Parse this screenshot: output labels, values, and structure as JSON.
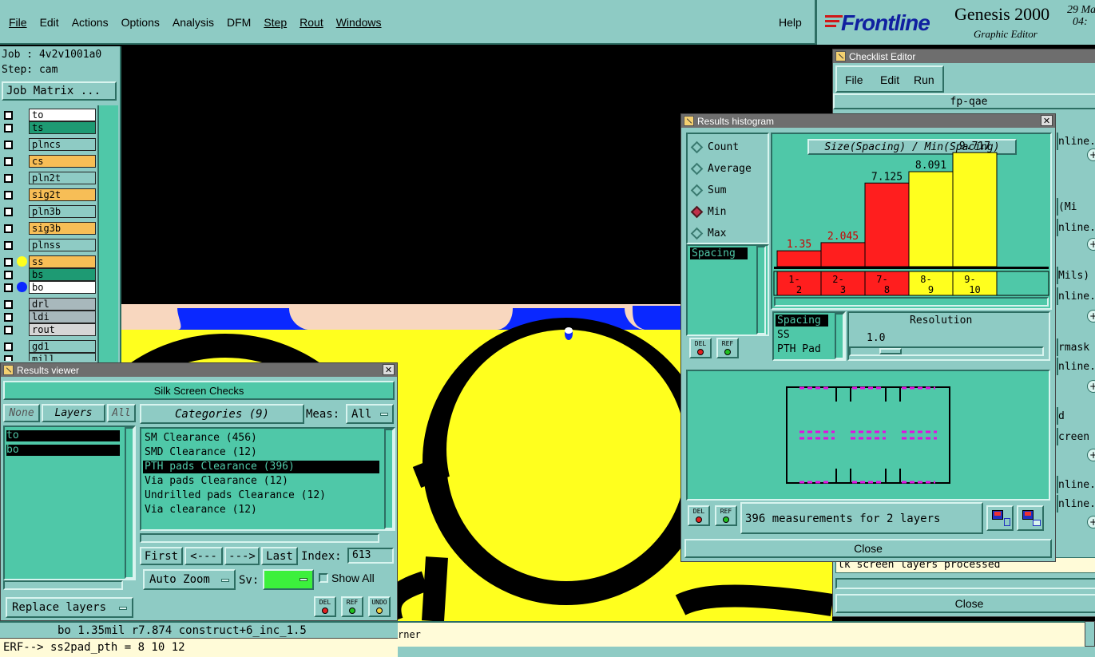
{
  "menubar": {
    "items": [
      "File",
      "Edit",
      "Actions",
      "Options",
      "Analysis",
      "DFM",
      "Step",
      "Rout",
      "Windows"
    ],
    "help": "Help"
  },
  "brand": {
    "logo": "Frontline",
    "title": "Genesis 2000",
    "subtitle": "Graphic Editor",
    "date_top": "29 Ma",
    "date_bottom": "04:"
  },
  "job": {
    "job_label": "Job : 4v2v1001a0",
    "step_label": "Step: cam",
    "matrix_button": "Job Matrix ..."
  },
  "layers": [
    {
      "name": "to",
      "color": "#ffffff"
    },
    {
      "name": "ts",
      "color": "#1e9a73"
    },
    {
      "name": "plncs",
      "color": "#8ecbc4"
    },
    {
      "name": "cs",
      "color": "#f7be56"
    },
    {
      "name": "pln2t",
      "color": "#8ecbc4"
    },
    {
      "name": "sig2t",
      "color": "#f7be56"
    },
    {
      "name": "pln3b",
      "color": "#8ecbc4"
    },
    {
      "name": "sig3b",
      "color": "#f7be56"
    },
    {
      "name": "plnss",
      "color": "#8ecbc4"
    },
    {
      "name": "ss",
      "color": "#f7be56"
    },
    {
      "name": "bs",
      "color": "#1e9a73"
    },
    {
      "name": "bo",
      "color": "#ffffff"
    },
    {
      "name": "drl",
      "color": "#a8b8bc"
    },
    {
      "name": "ldi",
      "color": "#a8b8bc"
    },
    {
      "name": "rout",
      "color": "#d6d6d6"
    },
    {
      "name": "gd1",
      "color": "#8ecbc4"
    },
    {
      "name": "mill",
      "color": "#8ecbc4"
    }
  ],
  "results_viewer": {
    "title": "Results viewer",
    "header": "Silk Screen Checks",
    "none_label": "None",
    "layers_label": "Layers",
    "all_label": "All",
    "categories_button": "Categories (9)",
    "meas_label": "Meas:",
    "meas_value": "All",
    "layer_list": [
      "to",
      "bo"
    ],
    "categories": [
      "SM Clearance (456)",
      "SMD Clearance (12)",
      "PTH pads Clearance (396)",
      "Via pads Clearance (12)",
      "Undrilled pads Clearance (12)",
      "Via clearance (12)"
    ],
    "selected_category": 2,
    "first": "First",
    "prev": "<---",
    "next": "--->",
    "last": "Last",
    "index_label": "Index:",
    "index_value": "613",
    "auto_zoom": "Auto Zoom",
    "sv_label": "Sv:",
    "show_all": "Show All",
    "replace_layers": "Replace layers",
    "del": "DEL",
    "ref": "REF",
    "undo": "UNDO"
  },
  "status": {
    "line1": "bo 1.35mil  r7.874  construct+6_inc_1.5",
    "line2": "ERF--> ss2pad_pth = 8 10 12",
    "hint": "rner"
  },
  "histogram": {
    "title": "Results histogram",
    "options": [
      "Count",
      "Average",
      "Sum",
      "Min",
      "Max"
    ],
    "selected_option": 3,
    "chart_title": "Size(Spacing) / Min(Spacing)",
    "axis_list": [
      "Spacing"
    ],
    "res_list": [
      "Spacing",
      "SS",
      "PTH Pad"
    ],
    "resolution_label": "Resolution",
    "resolution_value": "1.0",
    "resolution_level": 0.15,
    "measurements": "396 measurements for 2 layers",
    "close": "Close",
    "del": "DEL",
    "ref": "REF"
  },
  "chart_data": {
    "type": "bar",
    "title": "Size(Spacing) / Min(Spacing)",
    "categories": [
      "1-2",
      "2-3",
      "7-8",
      "8-9",
      "9-10"
    ],
    "cat_top": [
      "1-",
      "2-",
      "7-",
      "8-",
      "9-"
    ],
    "cat_bottom": [
      "2",
      "3",
      "8",
      "9",
      "10"
    ],
    "values": [
      1.35,
      2.045,
      7.125,
      8.091,
      9.717
    ],
    "labels": [
      "1.35",
      "2.045",
      "7.125",
      "8.091",
      "9.717"
    ],
    "colors": [
      "#ff1e1e",
      "#ff1e1e",
      "#ff1e1e",
      "#ffff1e",
      "#ffff1e"
    ],
    "label_colors": [
      "#cc0000",
      "#cc0000",
      "#000000",
      "#000000",
      "#000000"
    ],
    "ylim": [
      0,
      10
    ]
  },
  "checklist": {
    "title": "Checklist Editor",
    "menu": [
      "File",
      "Edit",
      "Run"
    ],
    "name": "fp-qae",
    "frags": [
      "nline...",
      "(Mi",
      "nline...",
      "Mils)",
      "nline...",
      "rmask",
      "nline...",
      "d",
      "creen",
      "nline..."
    ],
    "footer": "lk screen layers processed",
    "close": "Close"
  }
}
